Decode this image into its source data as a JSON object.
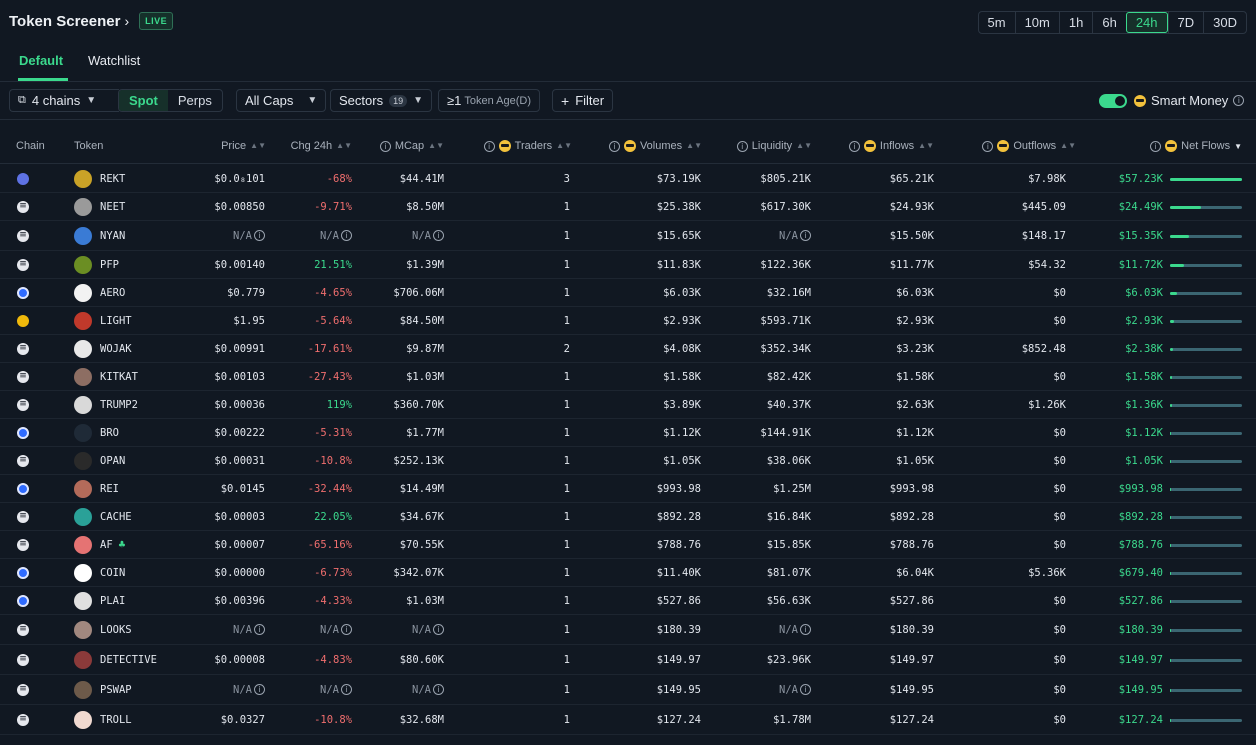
{
  "header": {
    "title": "Token Screener",
    "live_label": "LIVE",
    "timeframes": [
      "5m",
      "10m",
      "1h",
      "6h",
      "24h",
      "7D",
      "30D"
    ],
    "active_timeframe": "24h"
  },
  "tabs": [
    {
      "label": "Default",
      "active": true
    },
    {
      "label": "Watchlist",
      "active": false
    }
  ],
  "filters": {
    "chains": "4 chains",
    "market_type": [
      "Spot",
      "Perps"
    ],
    "active_market": "Spot",
    "caps": "All Caps",
    "sectors": "Sectors",
    "sectors_count": "19",
    "token_age_prefix": "≥1",
    "token_age": "Token Age(D)",
    "filter": "Filter",
    "smart_money": "Smart Money",
    "smart_money_on": true
  },
  "columns": {
    "chain": "Chain",
    "token": "Token",
    "price": "Price",
    "chg": "Chg 24h",
    "mcap": "MCap",
    "traders": "Traders",
    "volumes": "Volumes",
    "liquidity": "Liquidity",
    "inflows": "Inflows",
    "outflows": "Outflows",
    "netflows": "Net Flows"
  },
  "rows": [
    {
      "chain": "ethereum",
      "token": "REKT",
      "price": "$0.0₈101",
      "chg": "-68%",
      "mcap": "$44.41M",
      "traders": "3",
      "volumes": "$73.19K",
      "liquidity": "$805.21K",
      "inflows": "$65.21K",
      "outflows": "$7.98K",
      "netflows": "$57.23K",
      "bar": 1.0,
      "icon": "#c9a227"
    },
    {
      "chain": "solana",
      "token": "NEET",
      "price": "$0.00850",
      "chg": "-9.71%",
      "mcap": "$8.50M",
      "traders": "1",
      "volumes": "$25.38K",
      "liquidity": "$617.30K",
      "inflows": "$24.93K",
      "outflows": "$445.09",
      "netflows": "$24.49K",
      "bar": 0.43,
      "icon": "#9a9a9a"
    },
    {
      "chain": "solana",
      "token": "NYAN",
      "price": "N/A",
      "chg": "N/A",
      "mcap": "N/A",
      "traders": "1",
      "volumes": "$15.65K",
      "liquidity": "N/A",
      "inflows": "$15.50K",
      "outflows": "$148.17",
      "netflows": "$15.35K",
      "bar": 0.27,
      "icon": "#3a7bd5"
    },
    {
      "chain": "solana",
      "token": "PFP",
      "price": "$0.00140",
      "chg": "21.51%",
      "mcap": "$1.39M",
      "traders": "1",
      "volumes": "$11.83K",
      "liquidity": "$122.36K",
      "inflows": "$11.77K",
      "outflows": "$54.32",
      "netflows": "$11.72K",
      "bar": 0.2,
      "icon": "#6b8e23"
    },
    {
      "chain": "base",
      "token": "AERO",
      "price": "$0.779",
      "chg": "-4.65%",
      "mcap": "$706.06M",
      "traders": "1",
      "volumes": "$6.03K",
      "liquidity": "$32.16M",
      "inflows": "$6.03K",
      "outflows": "$0",
      "netflows": "$6.03K",
      "bar": 0.1,
      "icon": "#f2f2f2"
    },
    {
      "chain": "bsc",
      "token": "LIGHT",
      "price": "$1.95",
      "chg": "-5.64%",
      "mcap": "$84.50M",
      "traders": "1",
      "volumes": "$2.93K",
      "liquidity": "$593.71K",
      "inflows": "$2.93K",
      "outflows": "$0",
      "netflows": "$2.93K",
      "bar": 0.05,
      "icon": "#c0392b"
    },
    {
      "chain": "solana",
      "token": "WOJAK",
      "price": "$0.00991",
      "chg": "-17.61%",
      "mcap": "$9.87M",
      "traders": "2",
      "volumes": "$4.08K",
      "liquidity": "$352.34K",
      "inflows": "$3.23K",
      "outflows": "$852.48",
      "netflows": "$2.38K",
      "bar": 0.04,
      "icon": "#e8e8e8"
    },
    {
      "chain": "solana",
      "token": "KITKAT",
      "price": "$0.00103",
      "chg": "-27.43%",
      "mcap": "$1.03M",
      "traders": "1",
      "volumes": "$1.58K",
      "liquidity": "$82.42K",
      "inflows": "$1.58K",
      "outflows": "$0",
      "netflows": "$1.58K",
      "bar": 0.03,
      "icon": "#8d6e63"
    },
    {
      "chain": "solana",
      "token": "TRUMP2",
      "price": "$0.00036",
      "chg": "119%",
      "mcap": "$360.70K",
      "traders": "1",
      "volumes": "$3.89K",
      "liquidity": "$40.37K",
      "inflows": "$2.63K",
      "outflows": "$1.26K",
      "netflows": "$1.36K",
      "bar": 0.025,
      "icon": "#d9d9d9"
    },
    {
      "chain": "base",
      "token": "BRO",
      "price": "$0.00222",
      "chg": "-5.31%",
      "mcap": "$1.77M",
      "traders": "1",
      "volumes": "$1.12K",
      "liquidity": "$144.91K",
      "inflows": "$1.12K",
      "outflows": "$0",
      "netflows": "$1.12K",
      "bar": 0.02,
      "icon": "#1f2a37"
    },
    {
      "chain": "solana",
      "token": "OPAN",
      "price": "$0.00031",
      "chg": "-10.8%",
      "mcap": "$252.13K",
      "traders": "1",
      "volumes": "$1.05K",
      "liquidity": "$38.06K",
      "inflows": "$1.05K",
      "outflows": "$0",
      "netflows": "$1.05K",
      "bar": 0.02,
      "icon": "#2a2a2a"
    },
    {
      "chain": "base",
      "token": "REI",
      "price": "$0.0145",
      "chg": "-32.44%",
      "mcap": "$14.49M",
      "traders": "1",
      "volumes": "$993.98",
      "liquidity": "$1.25M",
      "inflows": "$993.98",
      "outflows": "$0",
      "netflows": "$993.98",
      "bar": 0.017,
      "icon": "#b36b5a"
    },
    {
      "chain": "solana",
      "token": "CACHE",
      "price": "$0.00003",
      "chg": "22.05%",
      "mcap": "$34.67K",
      "traders": "1",
      "volumes": "$892.28",
      "liquidity": "$16.84K",
      "inflows": "$892.28",
      "outflows": "$0",
      "netflows": "$892.28",
      "bar": 0.015,
      "icon": "#2aa198"
    },
    {
      "chain": "solana",
      "token": "AF",
      "price": "$0.00007",
      "chg": "-65.16%",
      "mcap": "$70.55K",
      "traders": "1",
      "volumes": "$788.76",
      "liquidity": "$15.85K",
      "inflows": "$788.76",
      "outflows": "$0",
      "netflows": "$788.76",
      "bar": 0.013,
      "icon": "#e57373"
    },
    {
      "chain": "base",
      "token": "COIN",
      "price": "$0.00000",
      "chg": "-6.73%",
      "mcap": "$342.07K",
      "traders": "1",
      "volumes": "$11.40K",
      "liquidity": "$81.07K",
      "inflows": "$6.04K",
      "outflows": "$5.36K",
      "netflows": "$679.40",
      "bar": 0.012,
      "icon": "#ffffff"
    },
    {
      "chain": "base",
      "token": "PLAI",
      "price": "$0.00396",
      "chg": "-4.33%",
      "mcap": "$1.03M",
      "traders": "1",
      "volumes": "$527.86",
      "liquidity": "$56.63K",
      "inflows": "$527.86",
      "outflows": "$0",
      "netflows": "$527.86",
      "bar": 0.009,
      "icon": "#e0e0e0"
    },
    {
      "chain": "solana",
      "token": "LOOKS",
      "price": "N/A",
      "chg": "N/A",
      "mcap": "N/A",
      "traders": "1",
      "volumes": "$180.39",
      "liquidity": "N/A",
      "inflows": "$180.39",
      "outflows": "$0",
      "netflows": "$180.39",
      "bar": 0.003,
      "icon": "#a1887f"
    },
    {
      "chain": "solana",
      "token": "DETECTIVE",
      "price": "$0.00008",
      "chg": "-4.83%",
      "mcap": "$80.60K",
      "traders": "1",
      "volumes": "$149.97",
      "liquidity": "$23.96K",
      "inflows": "$149.97",
      "outflows": "$0",
      "netflows": "$149.97",
      "bar": 0.003,
      "icon": "#8b3a3a"
    },
    {
      "chain": "solana",
      "token": "PSWAP",
      "price": "N/A",
      "chg": "N/A",
      "mcap": "N/A",
      "traders": "1",
      "volumes": "$149.95",
      "liquidity": "N/A",
      "inflows": "$149.95",
      "outflows": "$0",
      "netflows": "$149.95",
      "bar": 0.003,
      "icon": "#6d5a4a"
    },
    {
      "chain": "solana",
      "token": "TROLL",
      "price": "$0.0327",
      "chg": "-10.8%",
      "mcap": "$32.68M",
      "traders": "1",
      "volumes": "$127.24",
      "liquidity": "$1.78M",
      "inflows": "$127.24",
      "outflows": "$0",
      "netflows": "$127.24",
      "bar": 0.002,
      "icon": "#f0d9d0"
    }
  ]
}
